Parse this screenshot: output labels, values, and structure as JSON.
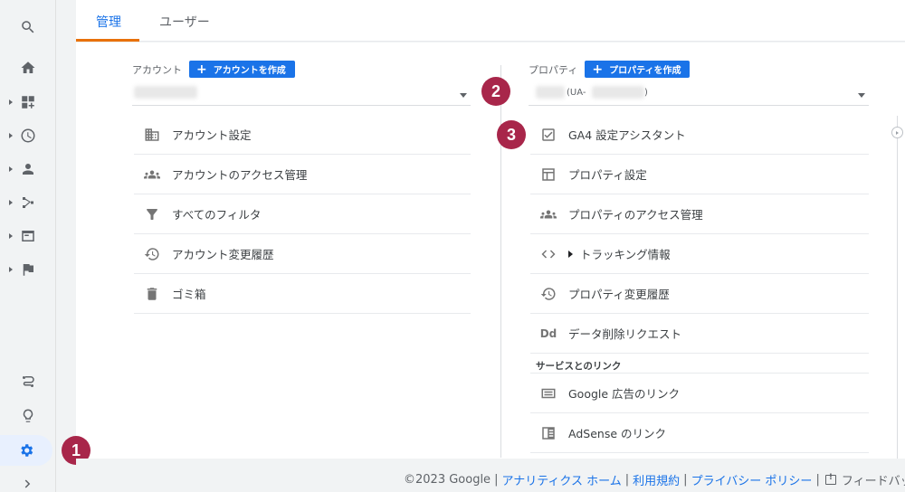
{
  "tabs": [
    {
      "label": "管理"
    },
    {
      "label": "ユーザー"
    }
  ],
  "rail": {
    "items": [
      "search-icon",
      "home-icon",
      "dashboard-icon",
      "clock-icon",
      "person-icon",
      "acquisition-icon",
      "behavior-icon",
      "flag-icon",
      "route-icon",
      "lightbulb-icon",
      "gear-icon",
      "chevron-right-icon"
    ]
  },
  "account": {
    "header": "アカウント",
    "create_label": "アカウントを作成",
    "items": [
      {
        "label": "アカウント設定",
        "icon": "building-icon"
      },
      {
        "label": "アカウントのアクセス管理",
        "icon": "people-icon"
      },
      {
        "label": "すべてのフィルタ",
        "icon": "filter-icon"
      },
      {
        "label": "アカウント変更履歴",
        "icon": "history-icon"
      },
      {
        "label": "ゴミ箱",
        "icon": "trash-icon"
      }
    ]
  },
  "property": {
    "header": "プロパティ",
    "create_label": "プロパティを作成",
    "select_prefix": "(UA-",
    "select_suffix": ")",
    "items": [
      {
        "label": "GA4 設定アシスタント",
        "icon": "checkbox-icon"
      },
      {
        "label": "プロパティ設定",
        "icon": "layout-icon"
      },
      {
        "label": "プロパティのアクセス管理",
        "icon": "people-icon"
      },
      {
        "label": "トラッキング情報",
        "icon": "code-icon"
      },
      {
        "label": "プロパティ変更履歴",
        "icon": "history-icon"
      },
      {
        "label": "データ削除リクエスト",
        "icon": "dd-icon"
      }
    ],
    "section_title": "サービスとのリンク",
    "link_items": [
      {
        "label": "Google 広告のリンク",
        "icon": "ads-icon"
      },
      {
        "label": "AdSense のリンク",
        "icon": "adsense-icon"
      }
    ]
  },
  "badges": [
    "1",
    "2",
    "3"
  ],
  "footer": {
    "copyright": "©2023 Google",
    "links": [
      "アナリティクス ホーム",
      "利用規約",
      "プライバシー ポリシー"
    ],
    "feedback": "フィードバッ"
  },
  "colors": {
    "accent": "#1a73e8",
    "tab_underline": "#e8710a",
    "badge": "#a8264a"
  }
}
